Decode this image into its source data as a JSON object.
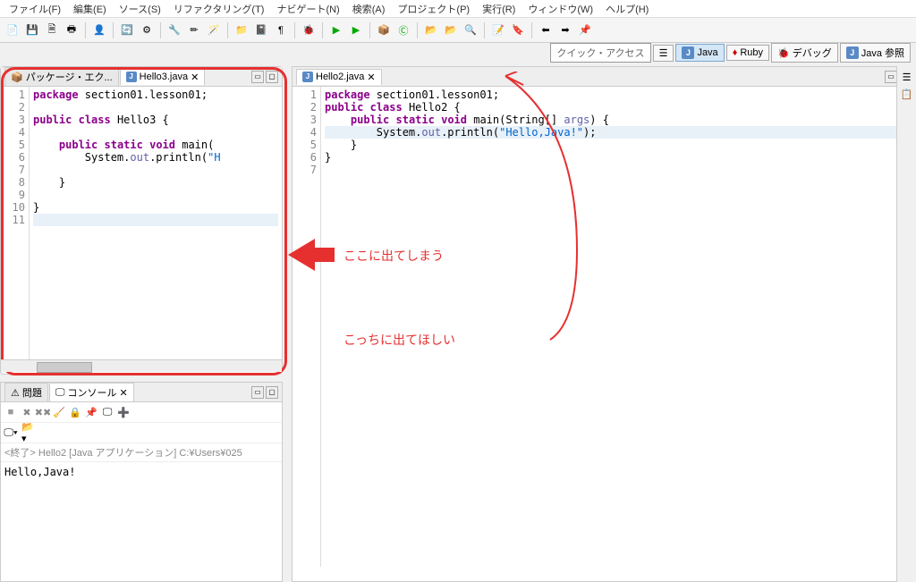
{
  "menu": {
    "file": "ファイル(F)",
    "edit": "編集(E)",
    "source": "ソース(S)",
    "refactor": "リファクタリング(T)",
    "navigate": "ナビゲート(N)",
    "search": "検索(A)",
    "project": "プロジェクト(P)",
    "run": "実行(R)",
    "window": "ウィンドウ(W)",
    "help": "ヘルプ(H)"
  },
  "quick_access": "クイック・アクセス",
  "perspectives": {
    "java": "Java",
    "ruby": "Ruby",
    "debug": "デバッグ",
    "java_ref": "Java 参照"
  },
  "left_tabs": {
    "package_explorer": "パッケージ・エク...",
    "hello3": "Hello3.java"
  },
  "right_tabs": {
    "hello2": "Hello2.java"
  },
  "editor_left": {
    "lines": [
      "1",
      "2",
      "3",
      "4",
      "5",
      "6",
      "7",
      "8",
      "9",
      "10",
      "11"
    ],
    "l1_kw1": "package",
    "l1_rest": " section01.lesson01;",
    "l3_kw1": "public",
    "l3_kw2": "class",
    "l3_name": "Hello3",
    "l3_brace": " {",
    "l5_kw1": "public",
    "l5_kw2": "static",
    "l5_kw3": "void",
    "l5_rest": " main(",
    "l6_a": "        System.",
    "l6_out": "out",
    "l6_b": ".println(",
    "l6_str": "\"H",
    "l8": "    }",
    "l10": "}"
  },
  "editor_right": {
    "lines": [
      "1",
      "2",
      "3",
      "4",
      "5",
      "6",
      "7"
    ],
    "l1_kw1": "package",
    "l1_rest": " section01.lesson01;",
    "l2_kw1": "public",
    "l2_kw2": "class",
    "l2_name": "Hello2",
    "l2_brace": " {",
    "l3_kw1": "public",
    "l3_kw2": "static",
    "l3_kw3": "void",
    "l3_rest": " main(String[] ",
    "l3_args": "args",
    "l3_end": ") {",
    "l4_a": "        System.",
    "l4_out": "out",
    "l4_b": ".println(",
    "l4_str": "\"Hello,Java!\"",
    "l4_end": ");",
    "l5": "    }",
    "l6": "}"
  },
  "bottom_tabs": {
    "problems": "問題",
    "console": "コンソール"
  },
  "console": {
    "terminated": "<終了> Hello2 [Java アプリケーション] C:¥Users¥025",
    "output": "Hello,Java!"
  },
  "annotations": {
    "here": "ここに出てしまう",
    "want": "こっちに出てほしい"
  }
}
